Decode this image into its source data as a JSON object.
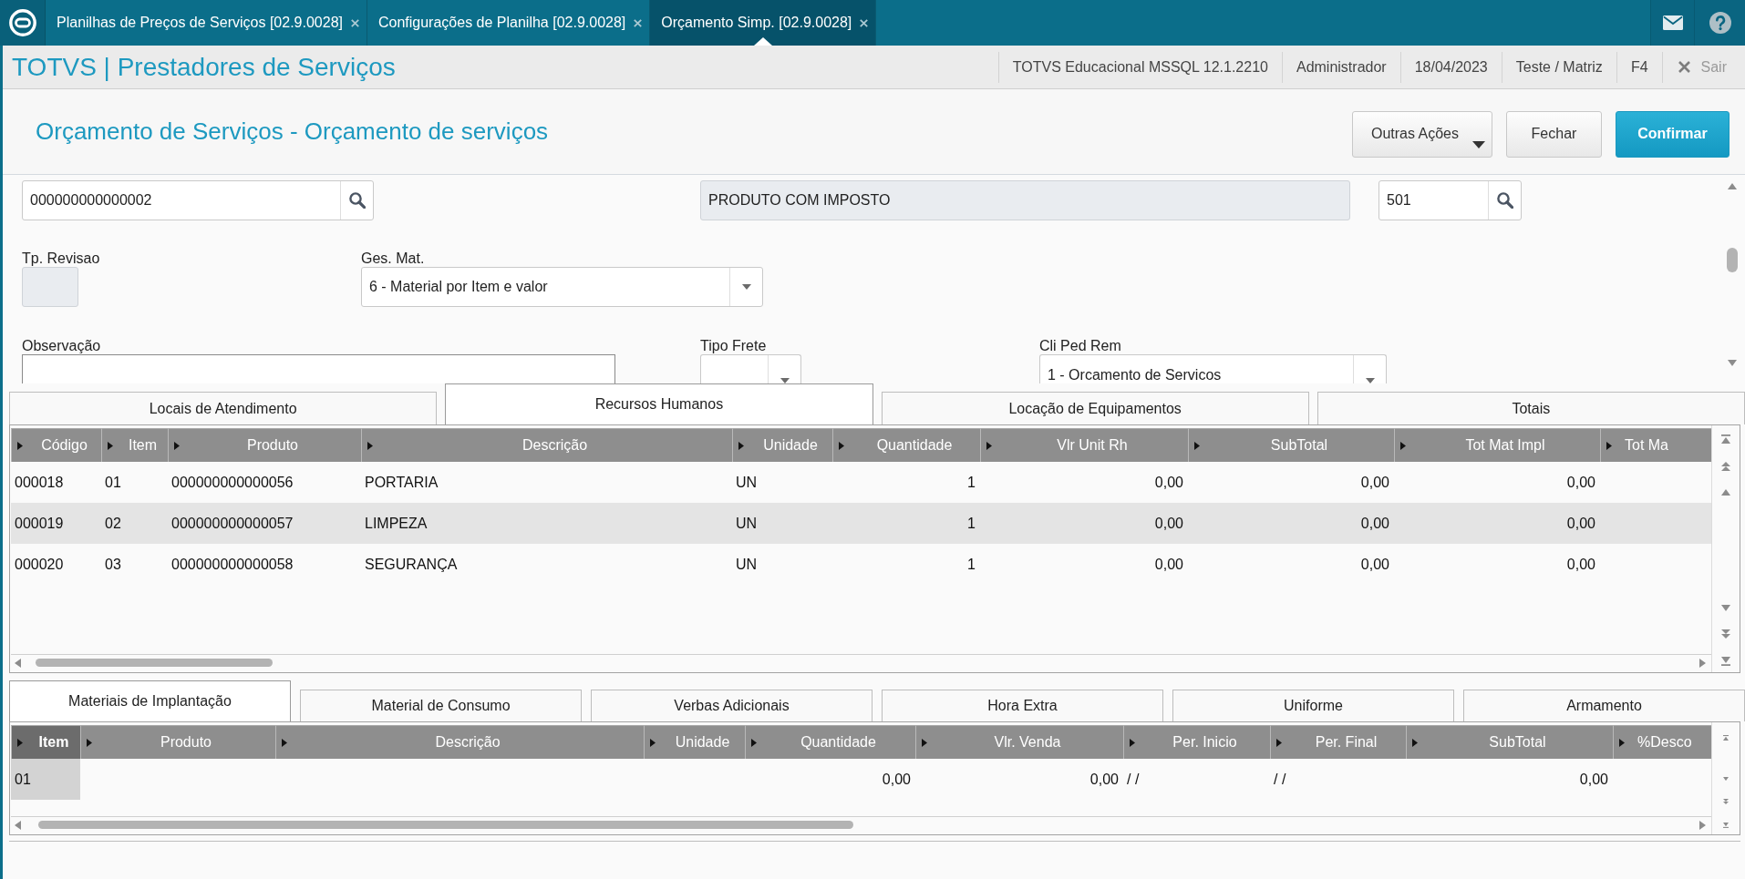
{
  "top_bar": {
    "tabs": [
      {
        "label": "Planilhas de Preços de Serviços [02.9.0028]",
        "selected": false
      },
      {
        "label": "Configurações de Planilha [02.9.0028]",
        "selected": false
      },
      {
        "label": "Orçamento Simp. [02.9.0028]",
        "selected": true
      }
    ]
  },
  "header": {
    "title": "TOTVS | Prestadores de Serviços",
    "info": [
      "TOTVS Educacional MSSQL 12.1.2210",
      "Administrador",
      "18/04/2023",
      "Teste / Matriz",
      "F4"
    ],
    "exit": {
      "label": "Sair"
    }
  },
  "page": {
    "title": "Orçamento de Serviços - Orçamento de serviços",
    "actions": [
      {
        "label": "Outras Ações",
        "kind": "menu"
      },
      {
        "label": "Fechar",
        "kind": "default"
      },
      {
        "label": "Confirmar",
        "kind": "primary"
      }
    ]
  },
  "form": {
    "rows": [
      [
        {
          "kind": "lookup",
          "value": "000000000000002",
          "disabled": false
        },
        {
          "kind": "text",
          "value": "PRODUTO COM IMPOSTO",
          "disabled": true
        },
        {
          "kind": "lookup",
          "value": "501",
          "disabled": false
        }
      ],
      [
        {
          "label": "Tp. Revisao",
          "kind": "text",
          "disabled": true
        },
        {
          "label": "Ges. Mat.",
          "kind": "select",
          "value": "6 - Material por Item e valor",
          "disabled": false
        }
      ],
      [
        {
          "label": "Observação",
          "kind": "textarea",
          "disabled": false
        },
        {
          "label": "Tipo Frete",
          "kind": "select",
          "disabled": false
        },
        {
          "label": "Cli Ped Rem",
          "kind": "select",
          "value": "1 - Orcamento de Servicos",
          "disabled": false
        }
      ]
    ]
  },
  "upper_tabs": [
    {
      "label": "Locais de Atendimento",
      "selected": false
    },
    {
      "label": "Recursos Humanos",
      "selected": true
    },
    {
      "label": "Locação de Equipamentos",
      "selected": false
    },
    {
      "label": "Totais",
      "selected": false
    }
  ],
  "upper_table": {
    "columns": [
      {
        "label": "Código",
        "selected": false
      },
      {
        "label": "Item",
        "selected": false
      },
      {
        "label": "Produto",
        "selected": false
      },
      {
        "label": "Descrição",
        "selected": false
      },
      {
        "label": "Unidade",
        "selected": false
      },
      {
        "label": "Quantidade",
        "selected": false
      },
      {
        "label": "Vlr Unit Rh",
        "selected": false
      },
      {
        "label": "SubTotal",
        "selected": false
      },
      {
        "label": "Tot Mat Impl",
        "selected": false
      },
      {
        "label": "Tot Ma",
        "selected": false
      }
    ],
    "rows": [
      [
        "000018",
        "01",
        "000000000000056",
        "PORTARIA",
        "UN",
        "1",
        "0,00",
        "0,00",
        "0,00"
      ],
      [
        "000019",
        "02",
        "000000000000057",
        "LIMPEZA",
        "UN",
        "1",
        "0,00",
        "0,00",
        "0,00"
      ],
      [
        "000020",
        "03",
        "000000000000058",
        "SEGURANÇA",
        "UN",
        "1",
        "0,00",
        "0,00",
        "0,00"
      ]
    ]
  },
  "lower_tabs": [
    {
      "label": "Materiais de Implantação",
      "selected": true
    },
    {
      "label": "Material de Consumo",
      "selected": false
    },
    {
      "label": "Verbas Adicionais",
      "selected": false
    },
    {
      "label": "Hora Extra",
      "selected": false
    },
    {
      "label": "Uniforme",
      "selected": false
    },
    {
      "label": "Armamento",
      "selected": false
    }
  ],
  "lower_table": {
    "columns": [
      {
        "label": "Item",
        "selected": true
      },
      {
        "label": "Produto",
        "selected": false
      },
      {
        "label": "Descrição",
        "selected": false
      },
      {
        "label": "Unidade",
        "selected": false
      },
      {
        "label": "Quantidade",
        "selected": false
      },
      {
        "label": "Vlr. Venda",
        "selected": false
      },
      {
        "label": "Per. Inicio",
        "selected": false
      },
      {
        "label": "Per. Final",
        "selected": false
      },
      {
        "label": "SubTotal",
        "selected": false
      },
      {
        "label": "%Desco",
        "selected": false
      }
    ],
    "rows": [
      [
        "01",
        null,
        null,
        null,
        "0,00",
        "0,00",
        "/ /",
        "/ /",
        "0,00"
      ]
    ]
  }
}
